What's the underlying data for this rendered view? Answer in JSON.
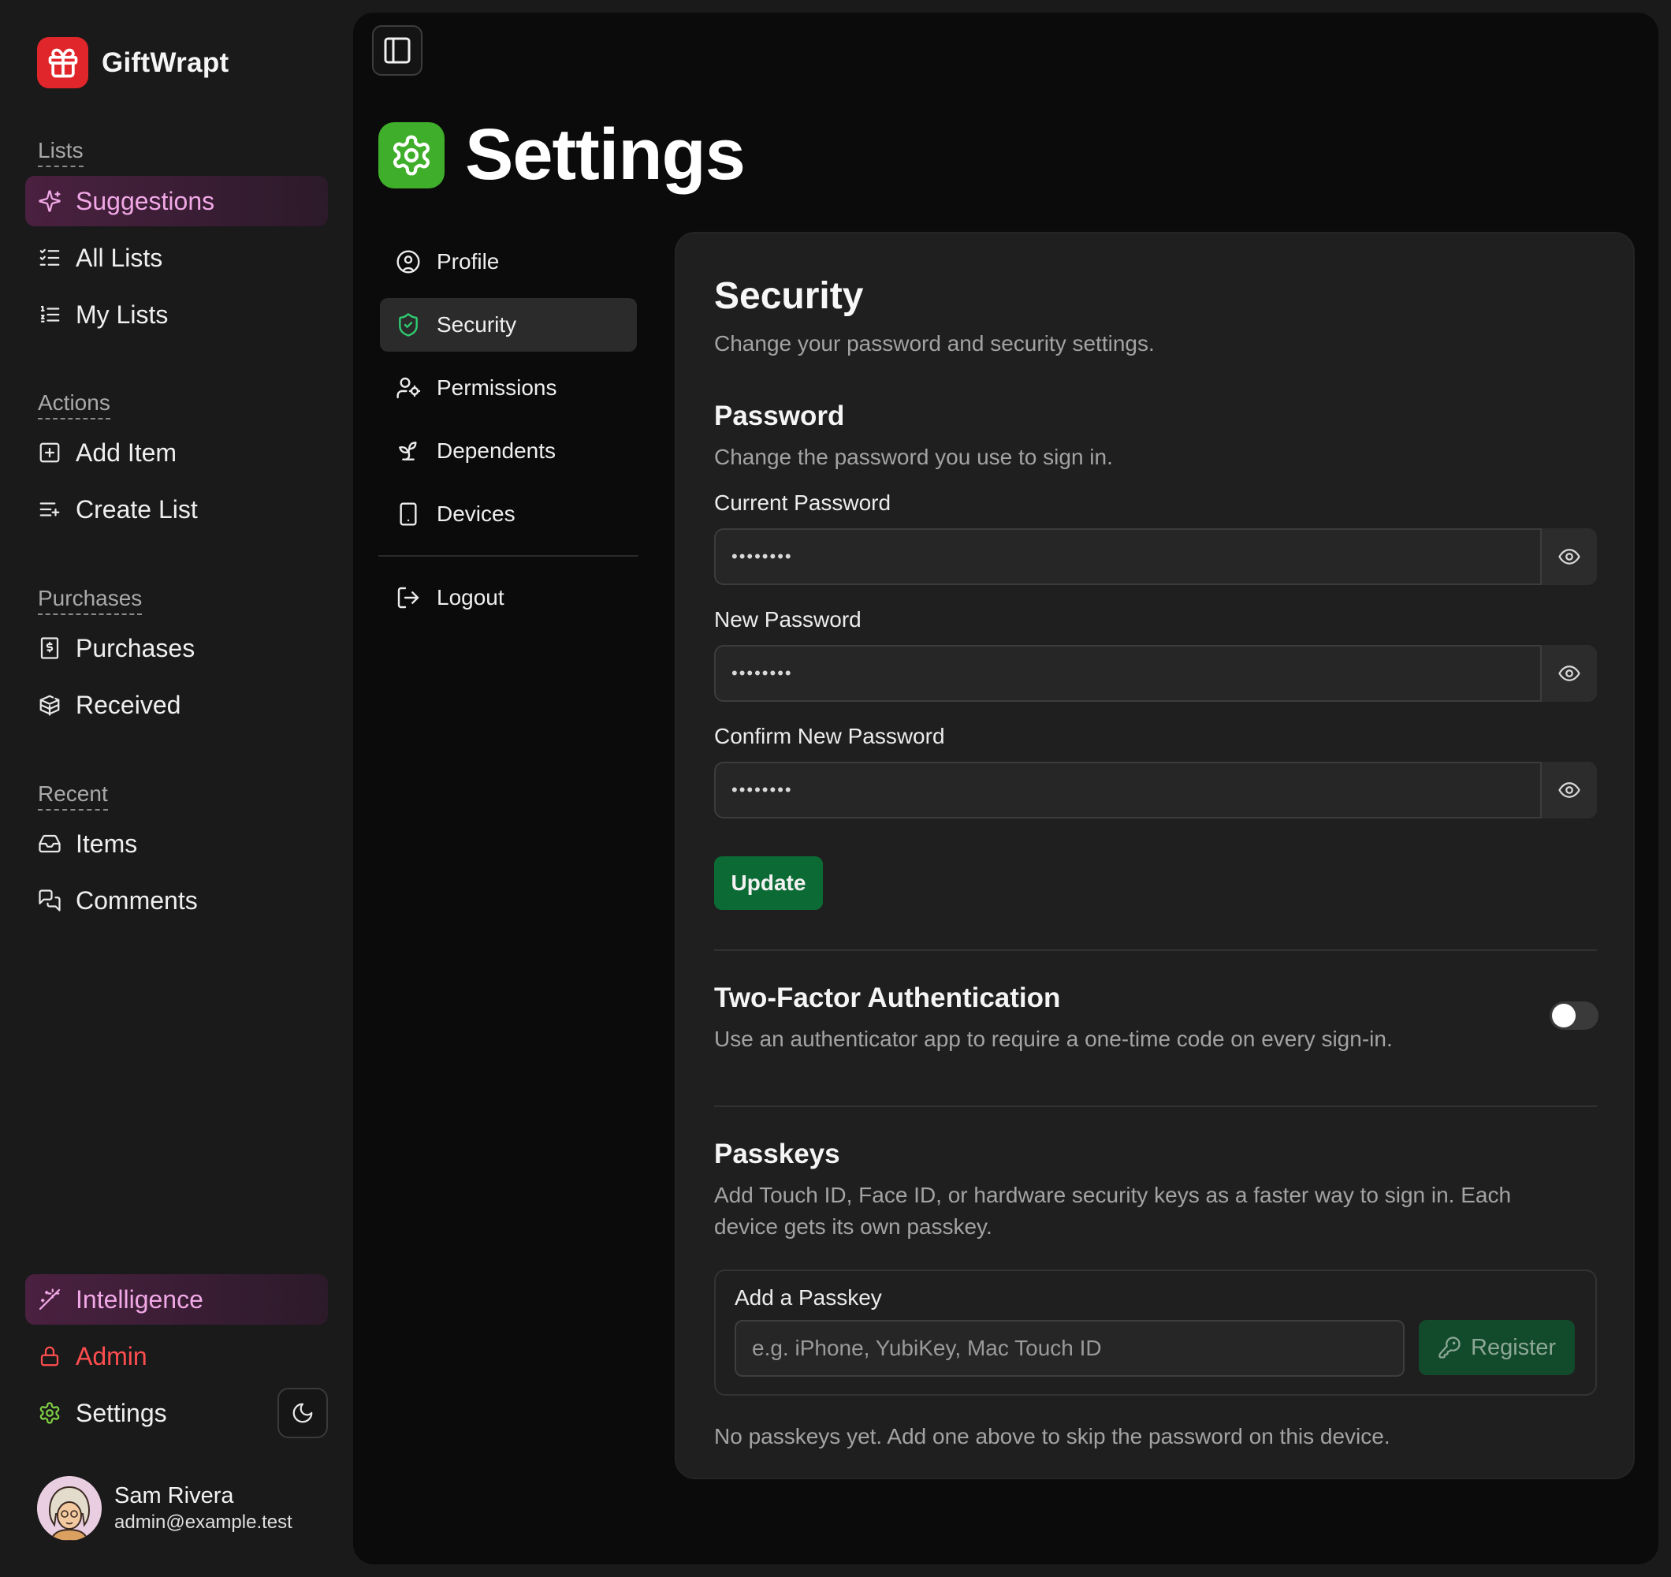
{
  "app": {
    "name": "GiftWrapt"
  },
  "sidebar": {
    "groups": [
      {
        "title": "Lists",
        "items": [
          {
            "label": "Suggestions"
          },
          {
            "label": "All Lists"
          },
          {
            "label": "My Lists"
          }
        ]
      },
      {
        "title": "Actions",
        "items": [
          {
            "label": "Add Item"
          },
          {
            "label": "Create List"
          }
        ]
      },
      {
        "title": "Purchases",
        "items": [
          {
            "label": "Purchases"
          },
          {
            "label": "Received"
          }
        ]
      },
      {
        "title": "Recent",
        "items": [
          {
            "label": "Items"
          },
          {
            "label": "Comments"
          }
        ]
      }
    ],
    "bottom": [
      {
        "label": "Intelligence"
      },
      {
        "label": "Admin"
      },
      {
        "label": "Settings"
      }
    ]
  },
  "user": {
    "name": "Sam Rivera",
    "email": "admin@example.test"
  },
  "page": {
    "title": "Settings"
  },
  "settings_nav": [
    {
      "label": "Profile"
    },
    {
      "label": "Security"
    },
    {
      "label": "Permissions"
    },
    {
      "label": "Dependents"
    },
    {
      "label": "Devices"
    },
    {
      "label": "Logout"
    }
  ],
  "security": {
    "title": "Security",
    "subtitle": "Change your password and security settings.",
    "password": {
      "title": "Password",
      "subtitle": "Change the password you use to sign in.",
      "fields": [
        {
          "label": "Current Password",
          "value": "••••••••"
        },
        {
          "label": "New Password",
          "value": "••••••••"
        },
        {
          "label": "Confirm New Password",
          "value": "••••••••"
        }
      ],
      "update_label": "Update"
    },
    "two_factor": {
      "title": "Two-Factor Authentication",
      "subtitle": "Use an authenticator app to require a one-time code on every sign-in.",
      "enabled": false
    },
    "passkeys": {
      "title": "Passkeys",
      "subtitle": "Add Touch ID, Face ID, or hardware security keys as a faster way to sign in. Each device gets its own passkey.",
      "add_title": "Add a Passkey",
      "input_placeholder": "e.g. iPhone, YubiKey, Mac Touch ID",
      "register_label": "Register",
      "empty_text": "No passkeys yet. Add one above to skip the password on this device."
    }
  },
  "colors": {
    "brand": "#e0262b",
    "accent_pink": "#f0a8e6",
    "settings_green": "#3fae2a",
    "update_green": "#0c6b34",
    "admin_red": "#ff4d4f",
    "security_shield": "#2ecc71"
  },
  "icons": {
    "brand": "gift-icon",
    "suggestions": "sparkles-icon",
    "all_lists": "list-checks-icon",
    "my_lists": "list-ordered-icon",
    "add_item": "plus-square-icon",
    "create_list": "list-plus-icon",
    "purchases": "receipt-icon",
    "received": "package-open-icon",
    "items": "inbox-icon",
    "comments": "messages-icon",
    "intelligence": "wand-icon",
    "admin": "lock-icon",
    "settings": "gear-icon",
    "theme": "moon-icon"
  }
}
